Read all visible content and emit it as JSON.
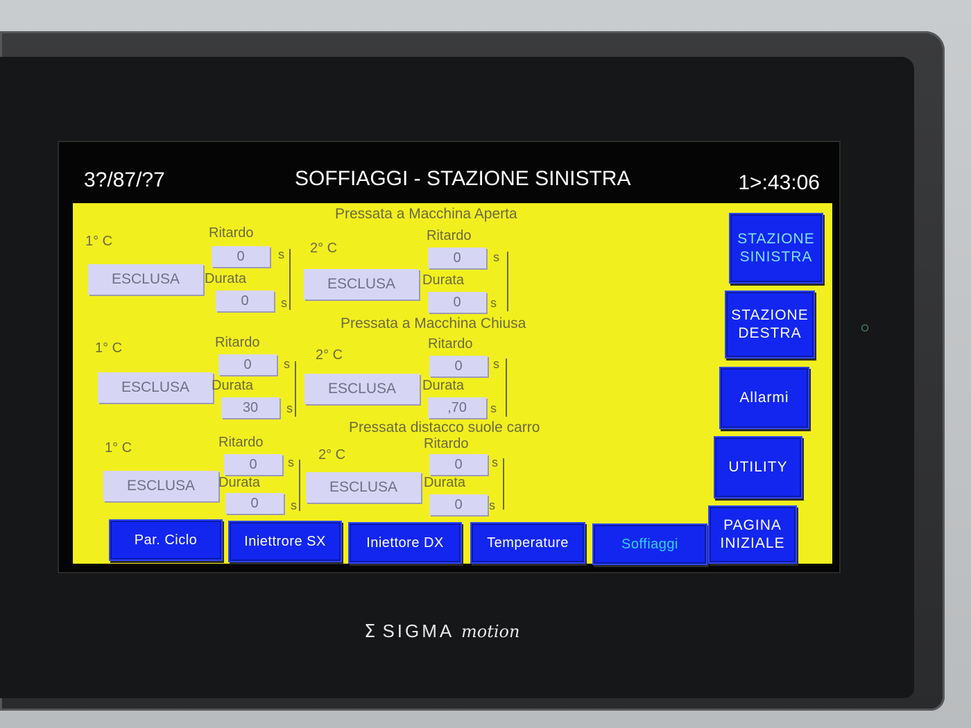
{
  "header": {
    "date": "3?/87/?7",
    "title": "SOFFIAGGI - STAZIONE SINISTRA",
    "clock": "1>:43:06"
  },
  "labels": {
    "ritardo": "Ritardo",
    "durata": "Durata",
    "unit": "s",
    "state": "ESCLUSA"
  },
  "sections": [
    {
      "title": "Pressata a Macchina Aperta",
      "channels": [
        {
          "label": "1° C",
          "state": "ESCLUSA",
          "ritardo": "0",
          "durata": "0"
        },
        {
          "label": "2° C",
          "state": "ESCLUSA",
          "ritardo": "0",
          "durata": "0"
        }
      ]
    },
    {
      "title": "Pressata a Macchina Chiusa",
      "channels": [
        {
          "label": "1° C",
          "state": "ESCLUSA",
          "ritardo": "0",
          "durata": "30"
        },
        {
          "label": "2° C",
          "state": "ESCLUSA",
          "ritardo": "0",
          "durata": ",70"
        }
      ]
    },
    {
      "title": "Pressata distacco suole carro",
      "channels": [
        {
          "label": "1° C",
          "state": "ESCLUSA",
          "ritardo": "0",
          "durata": "0"
        },
        {
          "label": "2° C",
          "state": "ESCLUSA",
          "ritardo": "0",
          "durata": "0"
        }
      ]
    }
  ],
  "bottom_nav": [
    {
      "label": "Par. Ciclo"
    },
    {
      "label": "Iniettrore SX"
    },
    {
      "label": "Iniettore DX"
    },
    {
      "label": "Temperature"
    },
    {
      "label": "Soffiaggi",
      "active": true
    }
  ],
  "side_nav": [
    {
      "label": "STAZIONE\nSINISTRA",
      "active": true
    },
    {
      "label": "STAZIONE\nDESTRA"
    },
    {
      "label": "Allarmi"
    },
    {
      "label": "UTILITY"
    },
    {
      "label": "PAGINA\nINIZIALE"
    }
  ],
  "brand": {
    "name": "SIGMA",
    "suffix": "motion"
  },
  "colors": {
    "panel": "#f2ef1f",
    "button": "#1226f0",
    "active_text": "#34d0ff"
  }
}
